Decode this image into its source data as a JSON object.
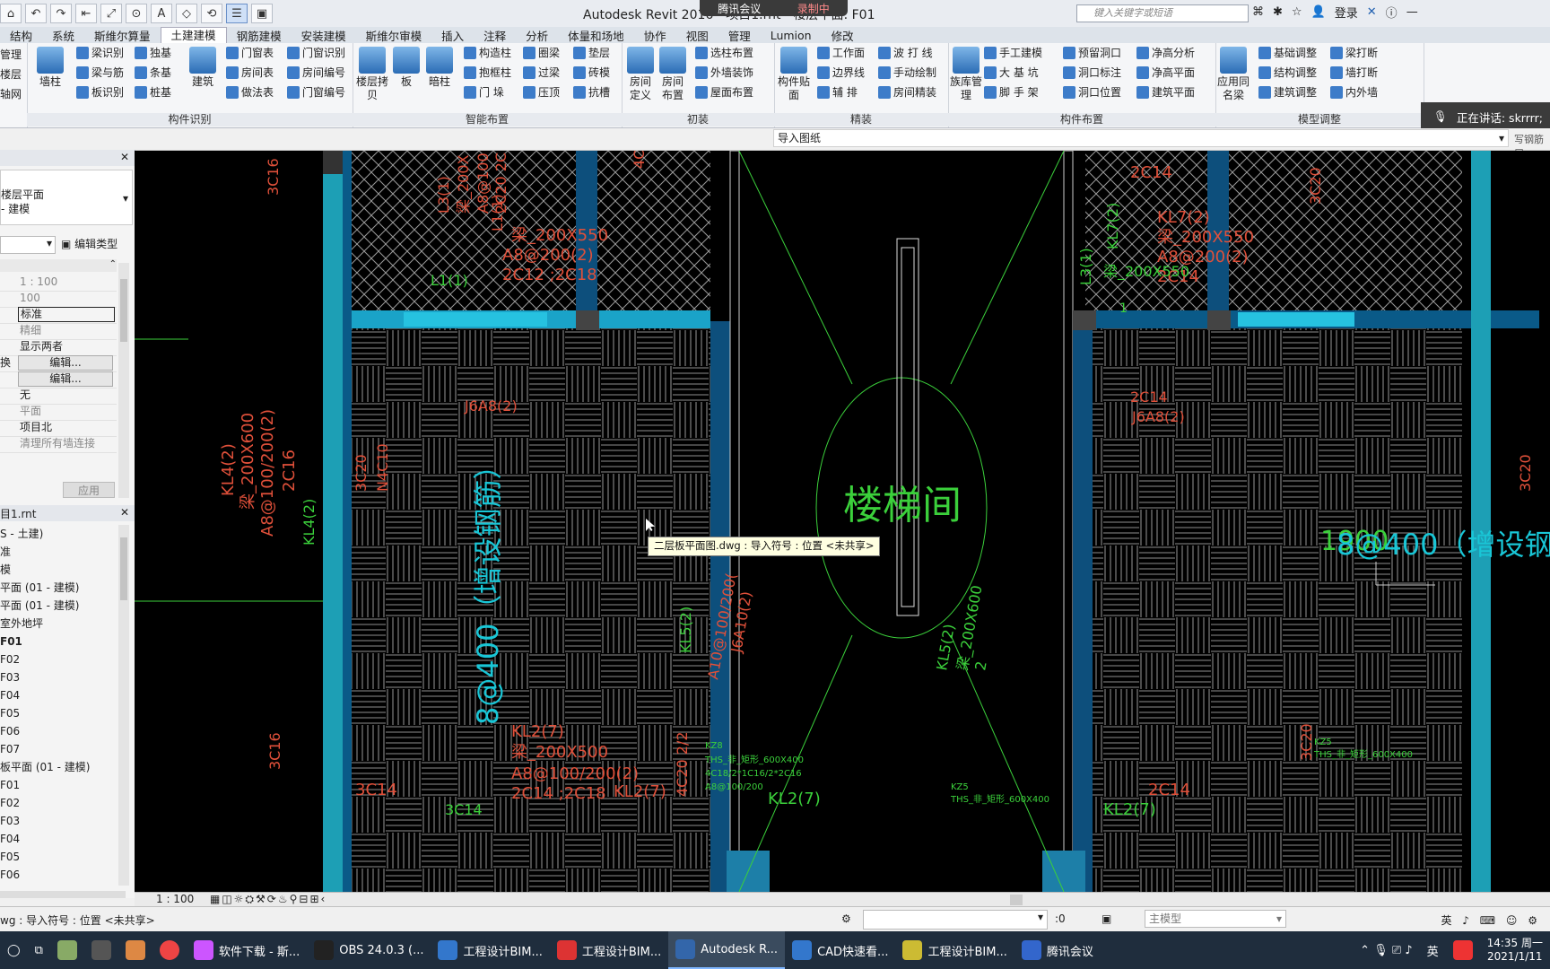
{
  "app": {
    "title": "Autodesk Revit 2016 -  项目1.rnt - 楼层平面: F01"
  },
  "meeting": {
    "item1": "腾讯会议",
    "item2": "录制中"
  },
  "search": {
    "placeholder": "键入关键字或短语"
  },
  "account": {
    "login": "登录"
  },
  "tabs": [
    "结构",
    "系统",
    "斯维尔算量",
    "土建建模",
    "钢筋建模",
    "安装建模",
    "斯维尔审模",
    "插入",
    "注释",
    "分析",
    "体量和场地",
    "协作",
    "视图",
    "管理",
    "Lumion",
    "修改"
  ],
  "active_tab": "土建建模",
  "ribbon": {
    "left_partial": [
      "管理",
      "楼层",
      "轴网"
    ],
    "group1": {
      "title": "构件识别",
      "big": "墙柱",
      "items": [
        "梁识别",
        "梁与筋",
        "板识别",
        "独基",
        "条基",
        "桩基"
      ],
      "big2": "建筑",
      "items2": [
        "门窗表",
        "房间表",
        "做法表",
        "门窗识别",
        "房间编号",
        "门窗编号"
      ]
    },
    "group2": {
      "title": "智能布置",
      "big": [
        "楼层拷贝",
        "板",
        "暗柱"
      ],
      "items": [
        "构造柱",
        "抱框柱",
        "门 垛",
        "圈梁",
        "过梁",
        "压顶",
        "垫层",
        "砖模",
        "抗槽"
      ]
    },
    "group3": {
      "title": "初装",
      "big": [
        "房间定义",
        "房间布置"
      ],
      "items": [
        "选柱布置",
        "外墙装饰",
        "屋面布置"
      ]
    },
    "group4": {
      "title": "精装",
      "big": "构件贴面",
      "items": [
        "工作面",
        "边界线",
        "辅 排",
        "波 打 线",
        "手动绘制",
        "房间精装"
      ]
    },
    "group5": {
      "title": "构件布置",
      "big": "族库管理",
      "items": [
        "手工建模",
        "大 基 坑",
        "脚 手 架",
        "预留洞口",
        "洞口标注",
        "洞口位置",
        "净高分析",
        "净高平面",
        "建筑平面"
      ]
    },
    "group6": {
      "title": "模型调整",
      "big": "应用同名梁",
      "items": [
        "基础调整",
        "结构调整",
        "建筑调整",
        "梁打断",
        "墙打断",
        "内外墙"
      ]
    }
  },
  "toast": {
    "text": "正在讲话: skrrrr;"
  },
  "options": {
    "layer": "导入图纸",
    "right": "写钢筋层"
  },
  "properties": {
    "close": "✕",
    "type_line1": "楼层平面",
    "type_line2": "- 建模",
    "edit_type": "编辑类型",
    "rows": [
      "1 : 100",
      "100",
      "标准",
      "精细",
      "显示两者",
      "编辑...",
      "编辑...",
      "无",
      "平面",
      "项目北",
      "清理所有墙连接"
    ],
    "row_label_at5": "换",
    "apply": "应用"
  },
  "browser": {
    "title": "目1.rnt",
    "items": [
      "S - 土建)",
      "准",
      "模",
      "平面 (01 - 建模)",
      "平面 (01 - 建模)",
      "室外地坪",
      "F01",
      "F02",
      "F03",
      "F04",
      "F05",
      "F06",
      "F07",
      "板平面 (01 - 建模)",
      "F01",
      "F02",
      "F03",
      "F04",
      "F05",
      "F06"
    ]
  },
  "canvas": {
    "room_label": "楼梯间",
    "annotations": [
      "3C16",
      "L3(1)",
      "梁_200X",
      "A8@100",
      "2C20 2C",
      "L1(1)",
      "梁_200X550",
      "A8@200(2)",
      "2C12 ;2C18",
      "L1(1)",
      "4C2",
      "2C14",
      "KL7(2)",
      "梁_200X550",
      "A8@200(2)",
      "2C14",
      "3C20",
      "L3(1)",
      "KL7(2)",
      "梁_200X550",
      "1",
      "J6A8(2)",
      "2C14",
      "J6A8(2)",
      "KL4(2)",
      "梁_200X600",
      "A8@100/200(2)",
      "2C16",
      "KL4(2)",
      "3C20",
      "N4C10",
      "KL5(2)",
      "A10@100/200(",
      "J6A10(2)",
      "KL5(2)",
      "梁_200X600",
      "2",
      "3C16",
      "KL2(7)",
      "梁_200X500",
      "A8@100/200(2)",
      "2C14 ;2C18",
      "3C14",
      "4C20 2/2",
      "KL2(7)",
      "3C14",
      "KL2(7)",
      "2C14",
      "KL2(7)",
      "KZ8",
      "THS_非_矩形_600X400",
      "4C18/2*1C16/2*2C16",
      "A8@100/200",
      "KZ5",
      "THS_非_矩形_600X400",
      "3C20",
      "KZ5",
      "THS_非_矩形_600X400",
      "3C20",
      "1900"
    ],
    "big_text1": "8@400（增设钢筋）",
    "big_text2": "8@400（增设钢筋",
    "tooltip": "二层板平面图.dwg : 导入符号 : 位置 <未共享>"
  },
  "viewbar": {
    "scale": "1 : 100"
  },
  "status": {
    "text": "wg : 导入符号 : 位置 <未共享>",
    "zero": ":0",
    "model": "主模型"
  },
  "taskbar": {
    "items": [
      "软件下载 - 斯...",
      "OBS 24.0.3 (...",
      "工程设计BIM...",
      "工程设计BIM...",
      "Autodesk R...",
      "CAD快速看...",
      "工程设计BIM...",
      "腾讯会议"
    ],
    "active": "Autodesk R...",
    "time": "14:35 周一",
    "date": "2021/1/11",
    "ime": "英"
  }
}
